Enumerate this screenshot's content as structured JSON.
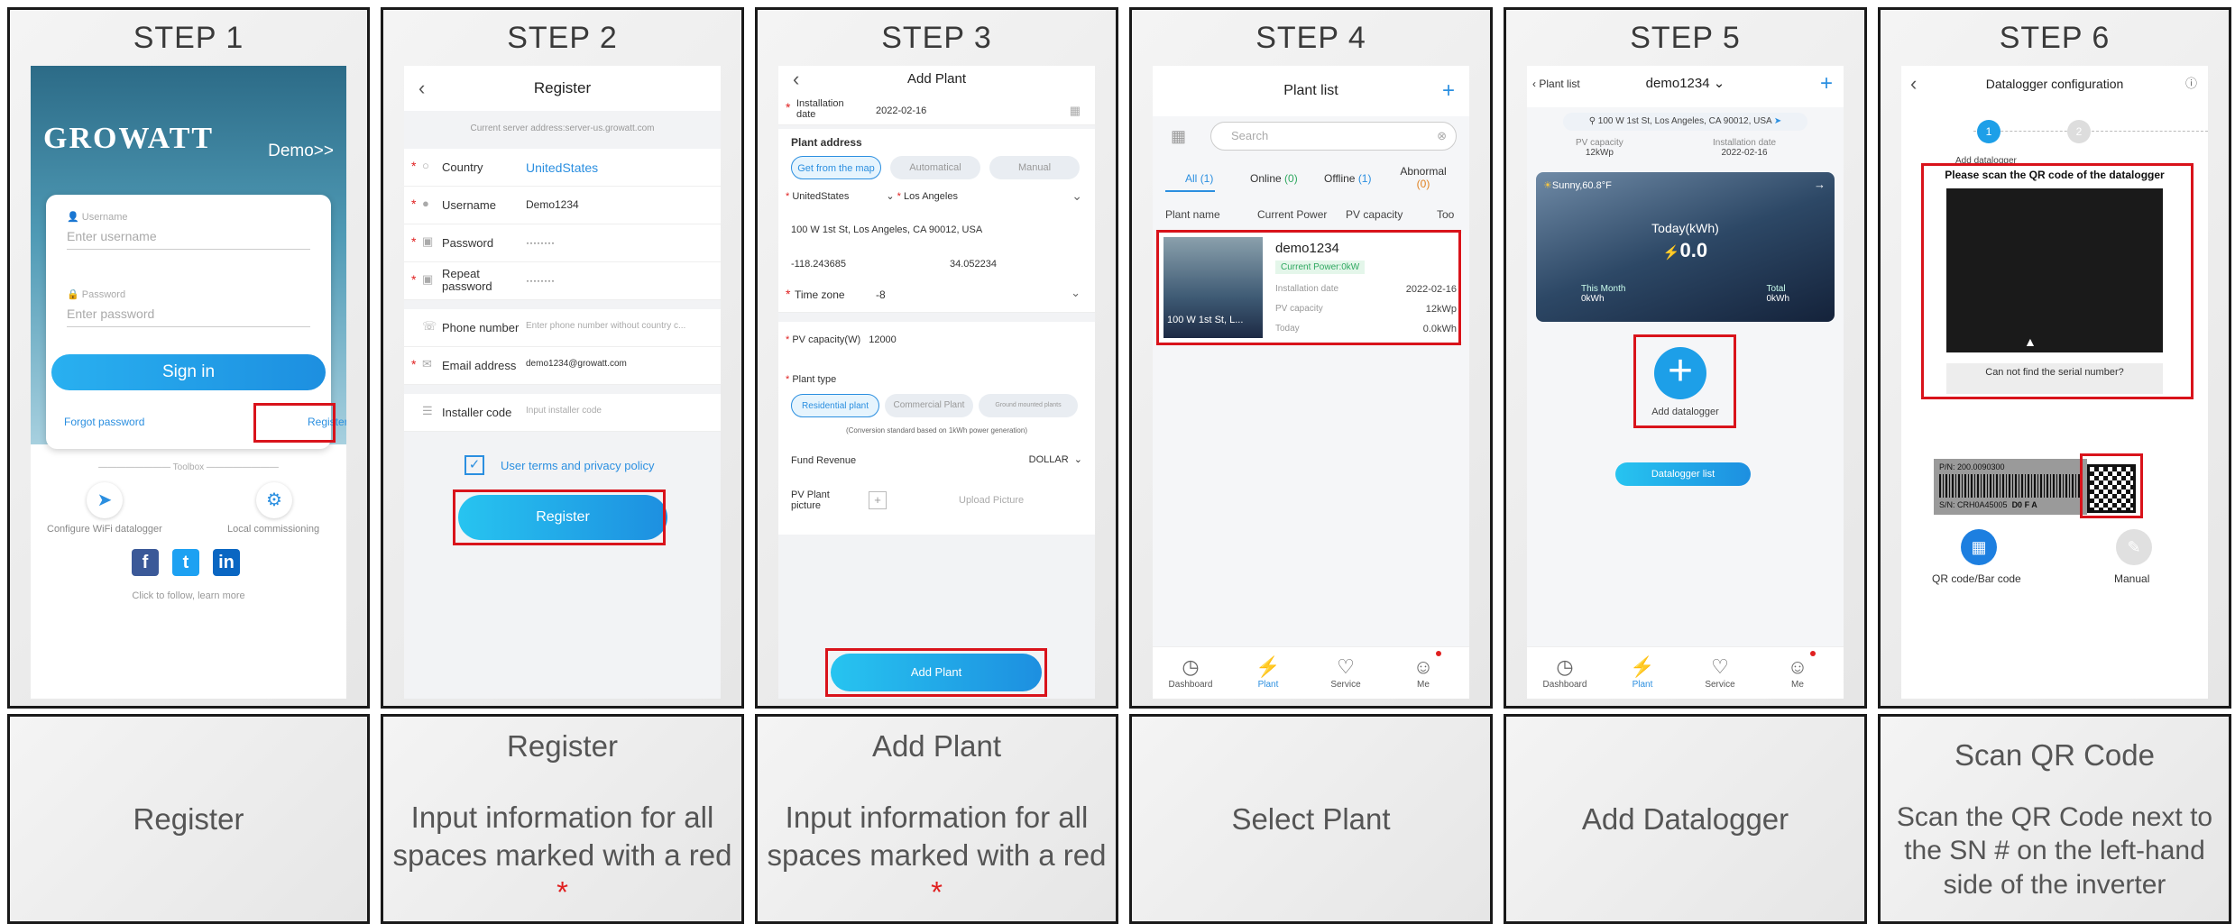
{
  "steps": [
    {
      "title": "STEP 1",
      "caption_heading": "",
      "caption": "Register"
    },
    {
      "title": "STEP 2",
      "caption_heading": "Register",
      "caption": "Input information for all spaces marked with a red",
      "caption_mark": "*"
    },
    {
      "title": "STEP 3",
      "caption_heading": "Add Plant",
      "caption": "Input information for all spaces marked with a red",
      "caption_mark": "*"
    },
    {
      "title": "STEP 4",
      "caption_heading": "",
      "caption": "Select Plant"
    },
    {
      "title": "STEP 5",
      "caption_heading": "",
      "caption": "Add Datalogger"
    },
    {
      "title": "STEP 6",
      "caption_heading": "Scan QR Code",
      "caption": "Scan the QR Code next to the SN # on the left-hand side of the inverter"
    }
  ],
  "s1": {
    "logo": "GROWATT",
    "demo": "Demo>>",
    "username_label": "Username",
    "username_ph": "Enter username",
    "password_label": "Password",
    "password_ph": "Enter password",
    "signin": "Sign in",
    "forgot": "Forgot password",
    "register": "Register",
    "toolbox": "Toolbox",
    "tool1": "Configure WiFi datalogger",
    "tool2": "Local commissioning",
    "follow": "Click to follow, learn more"
  },
  "s2": {
    "title": "Register",
    "server": "Current server address:server-us.growatt.com",
    "country_label": "Country",
    "country": "UnitedStates",
    "username_label": "Username",
    "username": "Demo1234",
    "password_label": "Password",
    "password": "········",
    "repeat_label": "Repeat password",
    "repeat": "········",
    "phone_label": "Phone number",
    "phone_ph": "Enter phone number without country c...",
    "email_label": "Email address",
    "email": "demo1234@growatt.com",
    "installer_label": "Installer code",
    "installer_ph": "Input installer code",
    "terms": "User terms and privacy policy",
    "register": "Register"
  },
  "s3": {
    "title": "Add Plant",
    "install_label": "Installation date",
    "install_date": "2022-02-16",
    "address_label": "Plant address",
    "map": "Get from the map",
    "auto": "Automatical",
    "manual": "Manual",
    "country": "UnitedStates",
    "city": "Los Angeles",
    "street": "100 W 1st St, Los Angeles, CA 90012, USA",
    "lng": "-118.243685",
    "lat": "34.052234",
    "tz_label": "Time zone",
    "tz": "-8",
    "pv_label": "PV capacity(W)",
    "pv": "12000",
    "type_label": "Plant type",
    "type1": "Residential plant",
    "type2": "Commercial Plant",
    "type3": "Ground mounted plants",
    "note": "(Conversion standard based on 1kWh power generation)",
    "fund_label": "Fund Revenue",
    "fund": "DOLLAR",
    "pic_label": "PV Plant picture",
    "upload": "Upload Picture",
    "add": "Add Plant"
  },
  "s4": {
    "title": "Plant list",
    "search": "Search",
    "all": "All",
    "all_n": "(1)",
    "online": "Online",
    "online_n": "(0)",
    "offline": "Offline",
    "offline_n": "(1)",
    "abnormal": "Abnormal",
    "abnormal_n": "(0)",
    "col1": "Plant name",
    "col2": "Current Power",
    "col3": "PV capacity",
    "col4": "Too",
    "plant": "demo1234",
    "status": "Current Power:0kW",
    "addr": "100 W 1st St, L...",
    "k1": "Installation date",
    "v1": "2022-02-16",
    "k2": "PV capacity",
    "v2": "12kWp",
    "k3": "Today",
    "v3": "0.0kWh"
  },
  "tabbar": {
    "dashboard": "Dashboard",
    "plant": "Plant",
    "service": "Service",
    "me": "Me"
  },
  "s5": {
    "back": "Plant list",
    "title": "demo1234",
    "address": "100 W 1st St, Los Angeles, CA 90012, USA",
    "pv_label": "PV capacity",
    "pv": "12kWp",
    "install_label": "Installation date",
    "install": "2022-02-16",
    "weather": "Sunny,60.8°F",
    "today_label": "Today(kWh)",
    "today": "0.0",
    "month_label": "This Month",
    "month": "0kWh",
    "total_label": "Total",
    "total": "0kWh",
    "add": "Add datalogger",
    "list": "Datalogger list"
  },
  "s6": {
    "title": "Datalogger configuration",
    "step1": "1",
    "step2": "2",
    "step_label": "Add datalogger",
    "scan_title": "Please scan the QR code of the datalogger",
    "cant_find": "Can not find the serial number?",
    "pn": "P/N: 200.0090300",
    "sn": "S/N: CRH0A45005",
    "df": "D0 F A",
    "qr": "QR code/Bar code",
    "manual": "Manual"
  },
  "colors": {
    "accent": "#2b8fe0",
    "highlight": "#d9131b",
    "required": "#e02020"
  }
}
